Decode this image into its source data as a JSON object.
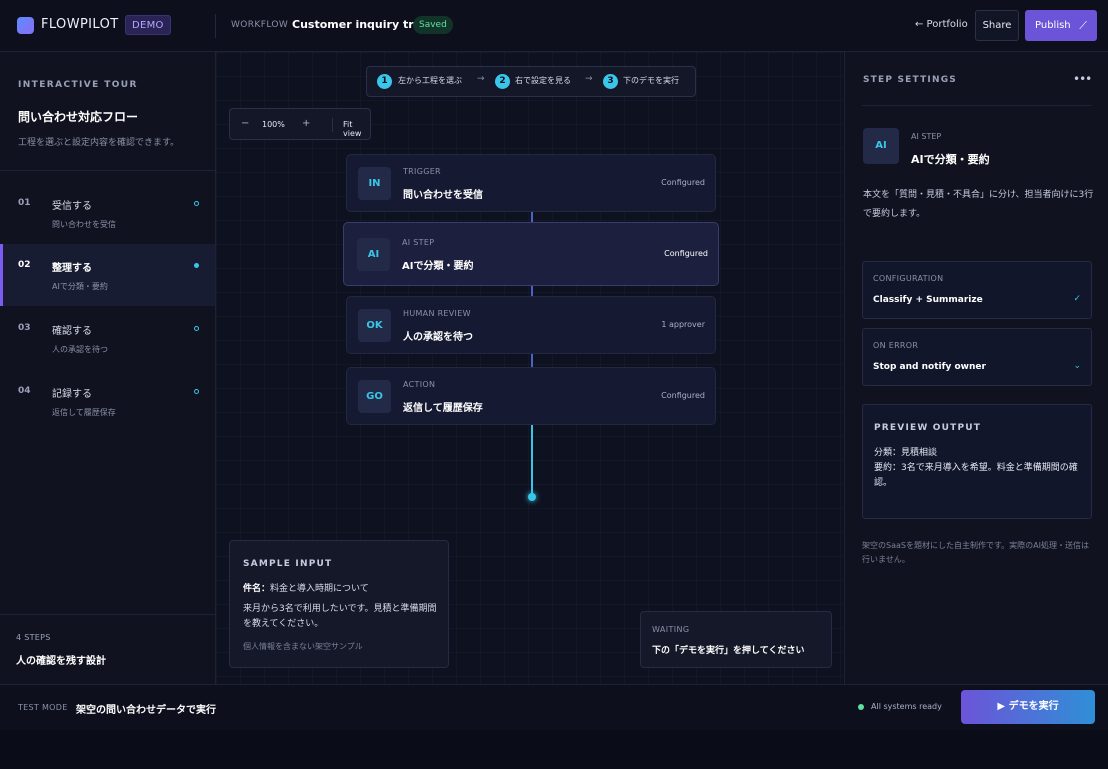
{
  "colors": {
    "accent_cyan": "#39c6e8",
    "accent_purple": "#6c54d8",
    "success_green": "#5ee0a2",
    "background": "#0f1220"
  },
  "header": {
    "brand": "FLOWPILOT",
    "demo_badge": "DEMO",
    "workflow_label": "WORKFLOW",
    "workflow_name": "Customer inquiry triage",
    "saved_badge": "Saved",
    "portfolio_link": "← Portfolio",
    "share_label": "Share",
    "publish_label": "Publish",
    "publish_icon": "pencil-icon"
  },
  "sidebar": {
    "tour_label": "INTERACTIVE TOUR",
    "title": "問い合わせ対応フロー",
    "subtitle": "工程を選ぶと設定内容を確認できます。",
    "steps": [
      {
        "num": "01",
        "title": "受信する",
        "desc": "問い合わせを受信",
        "active": false
      },
      {
        "num": "02",
        "title": "整理する",
        "desc": "AIで分類・要約",
        "active": true
      },
      {
        "num": "03",
        "title": "確認する",
        "desc": "人の承認を待つ",
        "active": false
      },
      {
        "num": "04",
        "title": "記録する",
        "desc": "返信して履歴保存",
        "active": false
      }
    ],
    "steps_count": "4 STEPS",
    "steps_note": "人の確認を残す設計"
  },
  "canvas": {
    "guide": [
      {
        "num": "1",
        "text": "左から工程を選ぶ"
      },
      {
        "num": "2",
        "text": "右で設定を見る"
      },
      {
        "num": "3",
        "text": "下のデモを実行"
      }
    ],
    "zoom": {
      "minus": "−",
      "value": "100%",
      "plus": "+",
      "fit": "Fit view"
    },
    "nodes": [
      {
        "icon": "IN",
        "kind": "TRIGGER",
        "title": "問い合わせを受信",
        "status": "Configured"
      },
      {
        "icon": "AI",
        "kind": "AI STEP",
        "title": "AIで分類・要約",
        "status": "Configured"
      },
      {
        "icon": "OK",
        "kind": "HUMAN REVIEW",
        "title": "人の承認を待つ",
        "status": "1 approver"
      },
      {
        "icon": "GO",
        "kind": "ACTION",
        "title": "返信して履歴保存",
        "status": "Configured"
      }
    ],
    "sample": {
      "label": "SAMPLE INPUT",
      "subject_key": "件名：",
      "subject_value": "料金と導入時期について",
      "body": "来月から3名で利用したいです。見積と準備期間を教えてください。",
      "note": "個人情報を含まない架空サンプル"
    },
    "waiting": {
      "label": "WAITING",
      "text": "下の「デモを実行」を押してください"
    }
  },
  "panel": {
    "label": "STEP SETTINGS",
    "menu": "•••",
    "icon": "AI",
    "kind": "AI STEP",
    "title": "AIで分類・要約",
    "description": "本文を「質問・見積・不具合」に分け、担当者向けに3行で要約します。",
    "configuration": {
      "label": "CONFIGURATION",
      "value": "Classify + Summarize",
      "icon": "✓"
    },
    "on_error": {
      "label": "ON ERROR",
      "value": "Stop and notify owner",
      "icon": "⌄"
    },
    "preview": {
      "label": "PREVIEW OUTPUT",
      "line1": "分類：見積相談",
      "line2": "要約：3名で来月導入を希望。料金と準備期間の確認。"
    },
    "footnote": "架空のSaaSを題材にした自主制作です。実際のAI処理・送信は行いません。"
  },
  "footer": {
    "mode_label": "TEST MODE",
    "mode_text": "架空の問い合わせデータで実行",
    "status": "All systems ready",
    "run_label": "▶ デモを実行"
  }
}
